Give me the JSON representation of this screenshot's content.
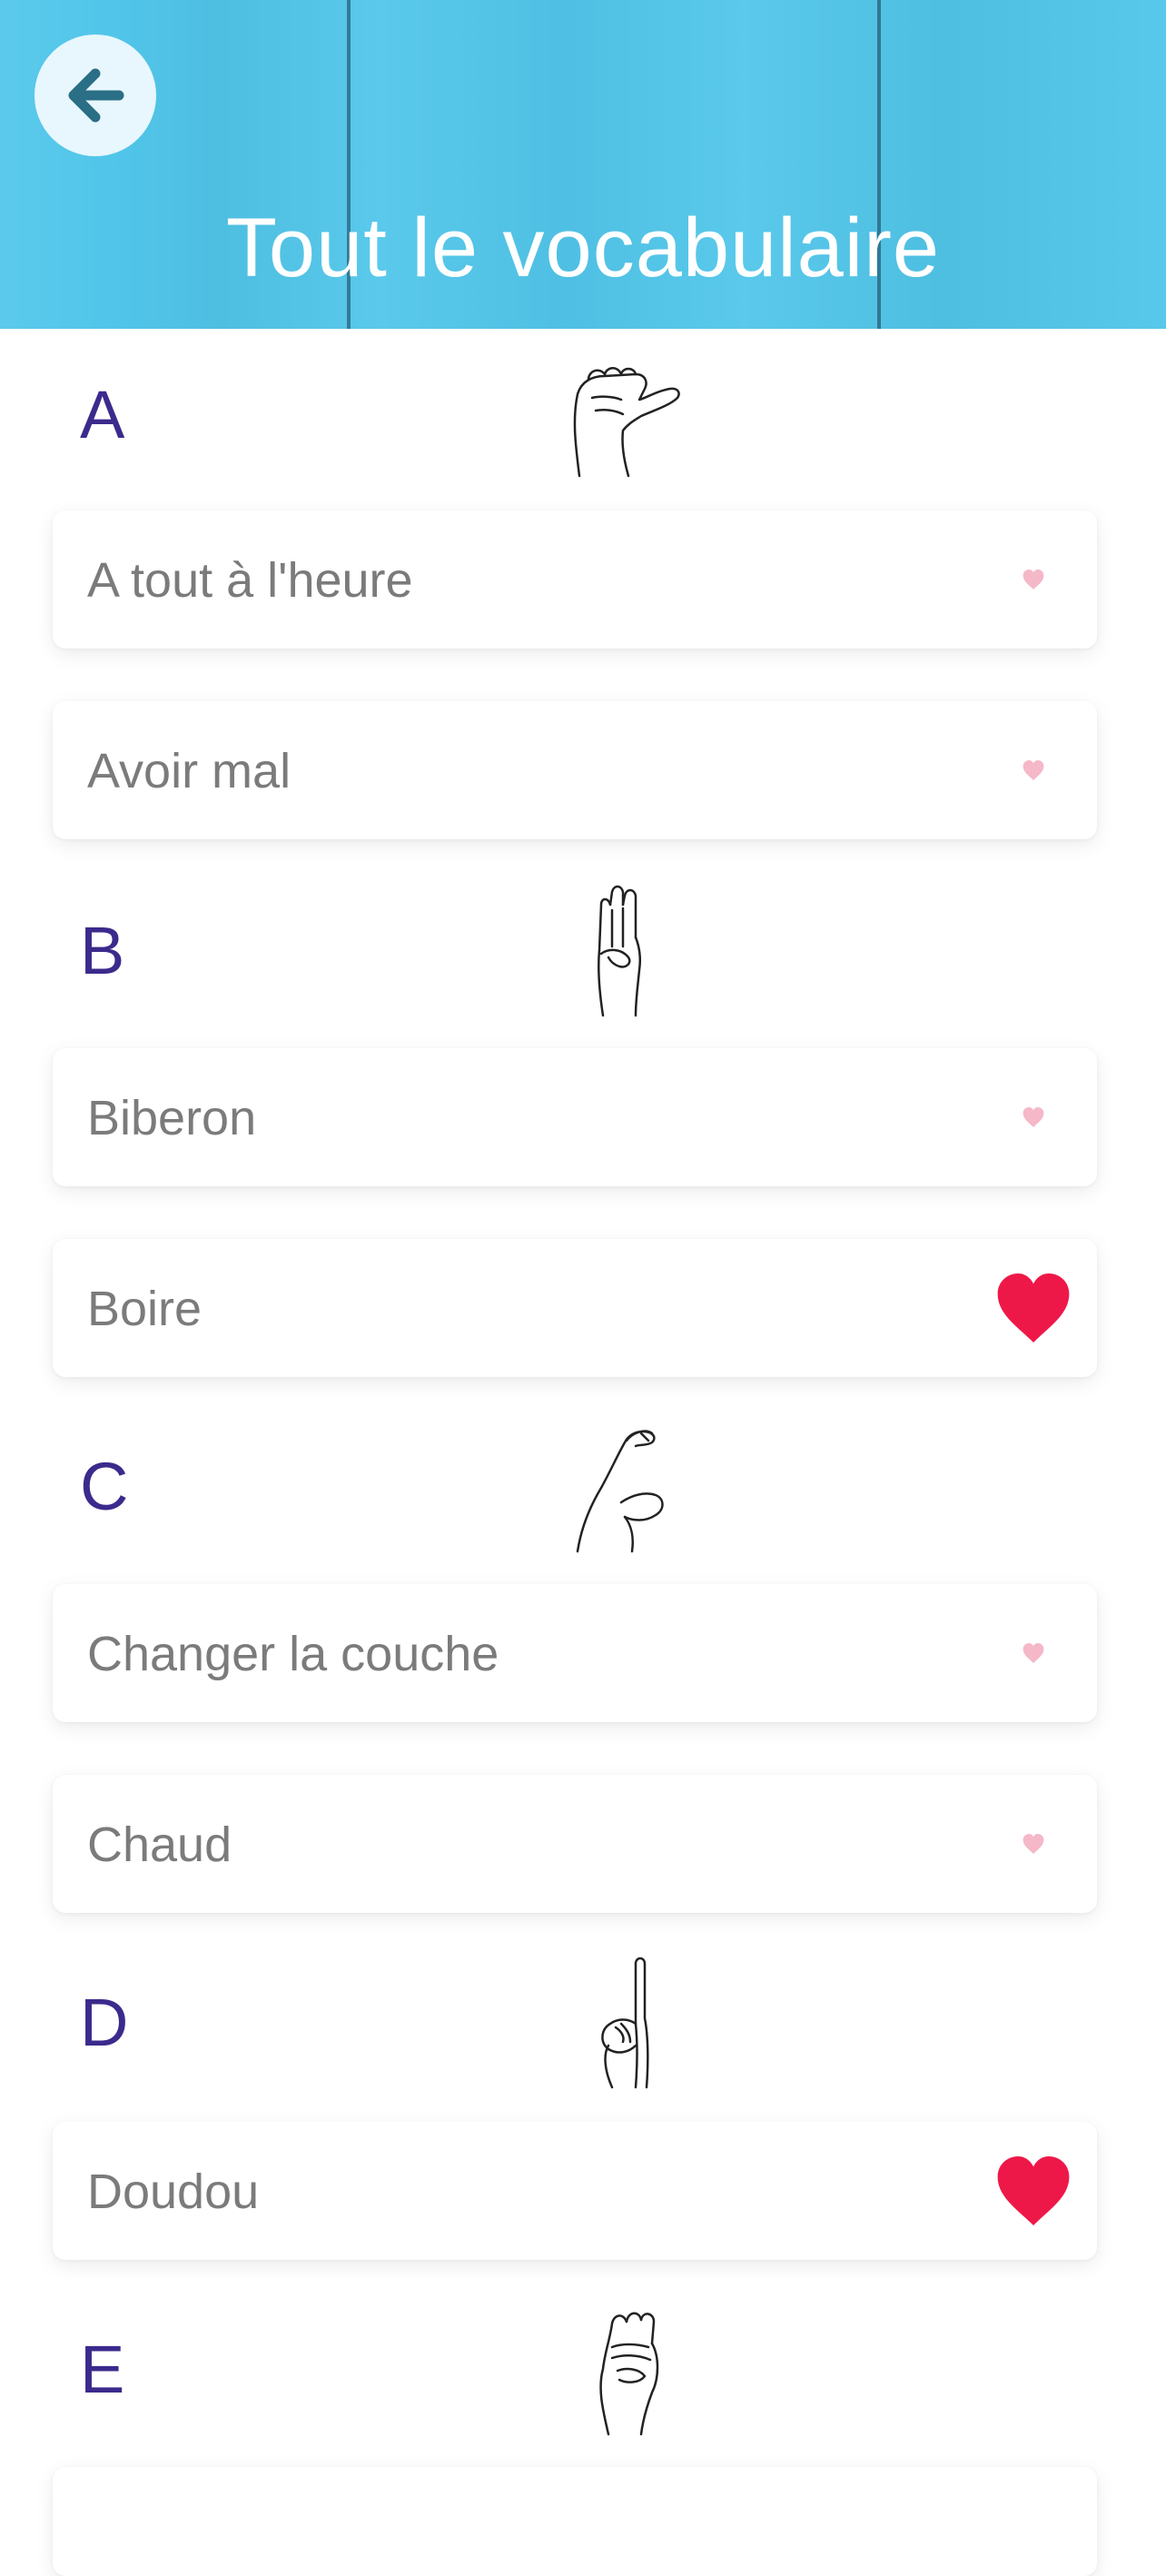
{
  "header": {
    "title": "Tout le vocabulaire",
    "back_icon": "arrow-left-icon",
    "background_color": "#51c6ea"
  },
  "sections": [
    {
      "letter": "A",
      "hand_icon": "sign-letter-a-hand-icon",
      "items": [
        {
          "label": "A tout à l'heure",
          "favorite": false
        },
        {
          "label": "Avoir mal",
          "favorite": false
        }
      ]
    },
    {
      "letter": "B",
      "hand_icon": "sign-letter-b-hand-icon",
      "items": [
        {
          "label": "Biberon",
          "favorite": false
        },
        {
          "label": "Boire",
          "favorite": true
        }
      ]
    },
    {
      "letter": "C",
      "hand_icon": "sign-letter-c-hand-icon",
      "items": [
        {
          "label": "Changer la couche",
          "favorite": false
        },
        {
          "label": "Chaud",
          "favorite": false
        }
      ]
    },
    {
      "letter": "D",
      "hand_icon": "sign-letter-d-hand-icon",
      "items": [
        {
          "label": "Doudou",
          "favorite": true
        }
      ]
    },
    {
      "letter": "E",
      "hand_icon": "sign-letter-e-hand-icon",
      "items": []
    }
  ],
  "colors": {
    "letter": "#3c2a8c",
    "item_text": "#7b7b7b",
    "heart_active": "#ee1848",
    "heart_inactive": "#f5b8c8"
  }
}
